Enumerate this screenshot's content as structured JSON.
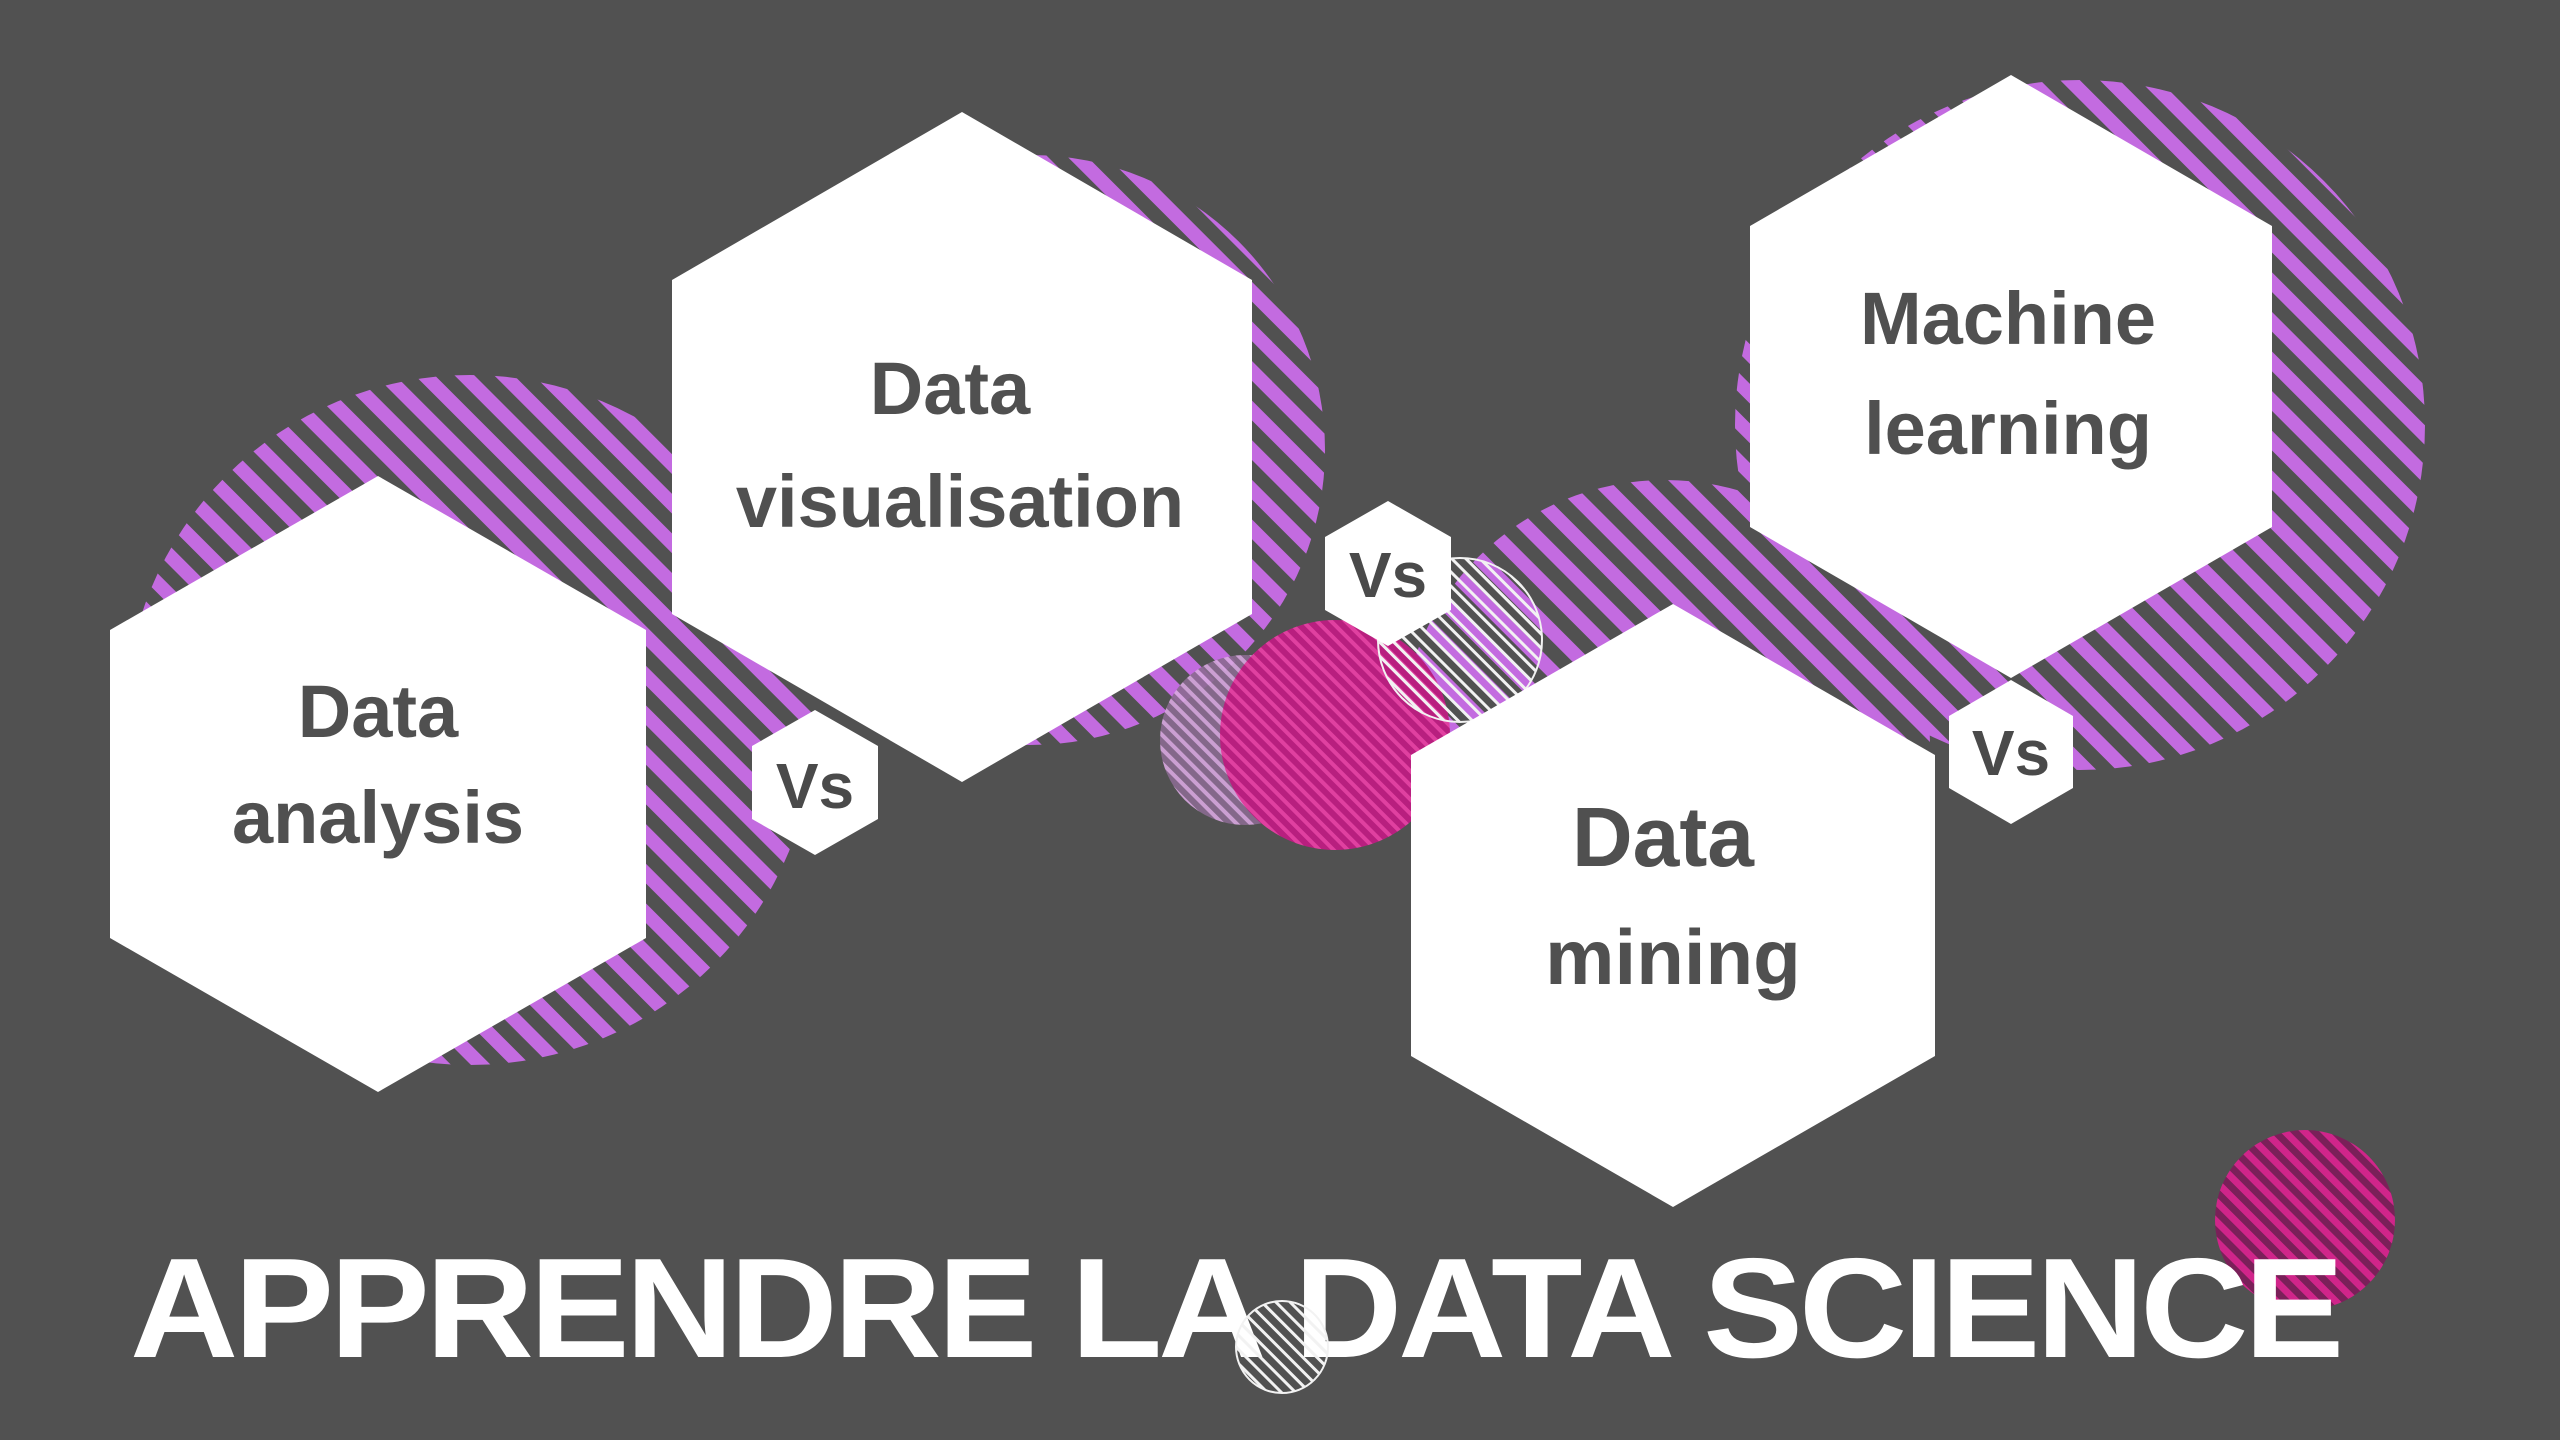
{
  "title": "APPRENDRE LA DATA SCIENCE",
  "colors": {
    "background": "#515151",
    "hexagon": "#ffffff",
    "hexagon_text": "#505050",
    "stripe_purple": "#c36be0",
    "stripe_magenta": "#c2187a",
    "title": "#ffffff"
  },
  "hexagons": [
    {
      "line1": "Data",
      "line2": "analysis"
    },
    {
      "line1": "Data",
      "line2": "visualisation"
    },
    {
      "line1": "Data",
      "line2": "mining"
    },
    {
      "line1": "Machine",
      "line2": "learning"
    }
  ],
  "connectors": [
    "Vs",
    "Vs",
    "Vs"
  ]
}
